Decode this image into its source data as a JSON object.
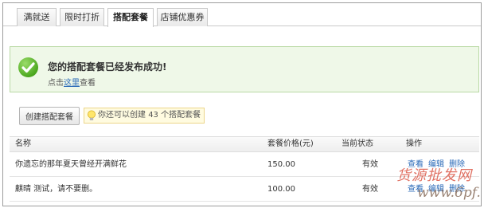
{
  "tabs": [
    {
      "label": "满就送",
      "active": false
    },
    {
      "label": "限时打折",
      "active": false
    },
    {
      "label": "搭配套餐",
      "active": true
    },
    {
      "label": "店铺优惠券",
      "active": false
    }
  ],
  "success": {
    "title": "您的搭配套餐已经发布成功!",
    "sub_prefix": "点击",
    "sub_link": "这里",
    "sub_suffix": "查看",
    "colors": {
      "border": "#b9d9a4",
      "background": "#eff8e8",
      "icon": "#4ca81f"
    }
  },
  "toolbar": {
    "create_label": "创建搭配套餐",
    "hint_prefix": "你还可以创建",
    "hint_count": "43",
    "hint_suffix": "个搭配套餐"
  },
  "table": {
    "headers": {
      "name": "名称",
      "price": "套餐价格(元)",
      "status": "当前状态",
      "ops": "操作"
    },
    "rows": [
      {
        "name": "你遗忘的那年夏天曾经开满鲜花",
        "price": "150.00",
        "status": "有效",
        "ops": [
          "查看",
          "编辑",
          "删除"
        ]
      },
      {
        "name": "麒晴 测试，请不要删。",
        "price": "100.00",
        "status": "有效",
        "ops": [
          "查看",
          "编辑",
          "删除"
        ]
      }
    ]
  },
  "watermark": {
    "line1": "货源批发网",
    "line2": "www.6pf.cn"
  }
}
